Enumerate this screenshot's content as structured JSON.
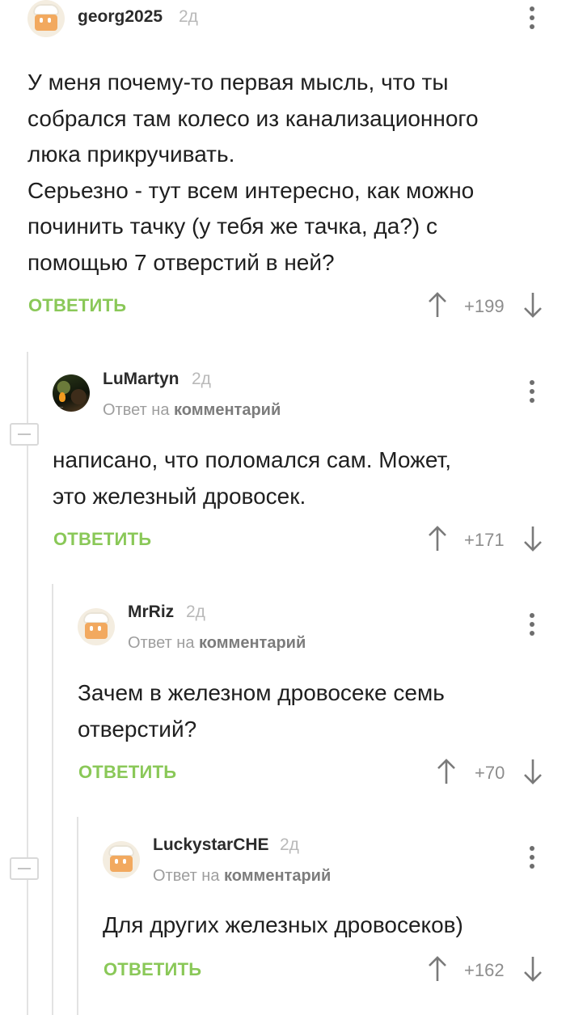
{
  "comments": [
    {
      "username": "georg2025",
      "time": "2д",
      "avatar": "house-avatar",
      "lines": [
        "У меня почему-то первая мысль, что ты",
        "собрался там колесо из канализационного",
        "люка прикручивать.",
        "Серьезно - тут всем интересно, как можно",
        "починить тачку (у тебя же тачка, да?) с",
        "помощью 7 отверстий в ней?"
      ],
      "reply_label": "ОТВЕТИТЬ",
      "score": "+199"
    },
    {
      "username": "LuMartyn",
      "time": "2д",
      "avatar": "photo-avatar",
      "avatar_caption": "...",
      "reply_to_prefix": "Ответ на",
      "reply_to_target": "комментарий",
      "lines": [
        "написано, что поломался сам. Может,",
        "это железный дровосек."
      ],
      "reply_label": "ОТВЕТИТЬ",
      "score": "+171"
    },
    {
      "username": "MrRiz",
      "time": "2д",
      "avatar": "house-avatar",
      "reply_to_prefix": "Ответ на",
      "reply_to_target": "комментарий",
      "lines": [
        "Зачем в железном дровосеке семь",
        "отверстий?"
      ],
      "reply_label": "ОТВЕТИТЬ",
      "score": "+70"
    },
    {
      "username": "LuckystarCHE",
      "time": "2д",
      "avatar": "house-avatar",
      "reply_to_prefix": "Ответ на",
      "reply_to_target": "комментарий",
      "lines": [
        "Для других железных дровосеков)"
      ],
      "reply_label": "ОТВЕТИТЬ",
      "score": "+162"
    }
  ],
  "icons": {
    "more": "kebab-menu-icon",
    "upvote": "arrow-up-icon",
    "downvote": "arrow-down-icon",
    "collapse": "collapse-thread-icon"
  },
  "colors": {
    "accent_green": "#8ac858",
    "text": "#1f1f1f",
    "muted": "#9e9e9e",
    "thread_line": "#e3e3e3"
  }
}
